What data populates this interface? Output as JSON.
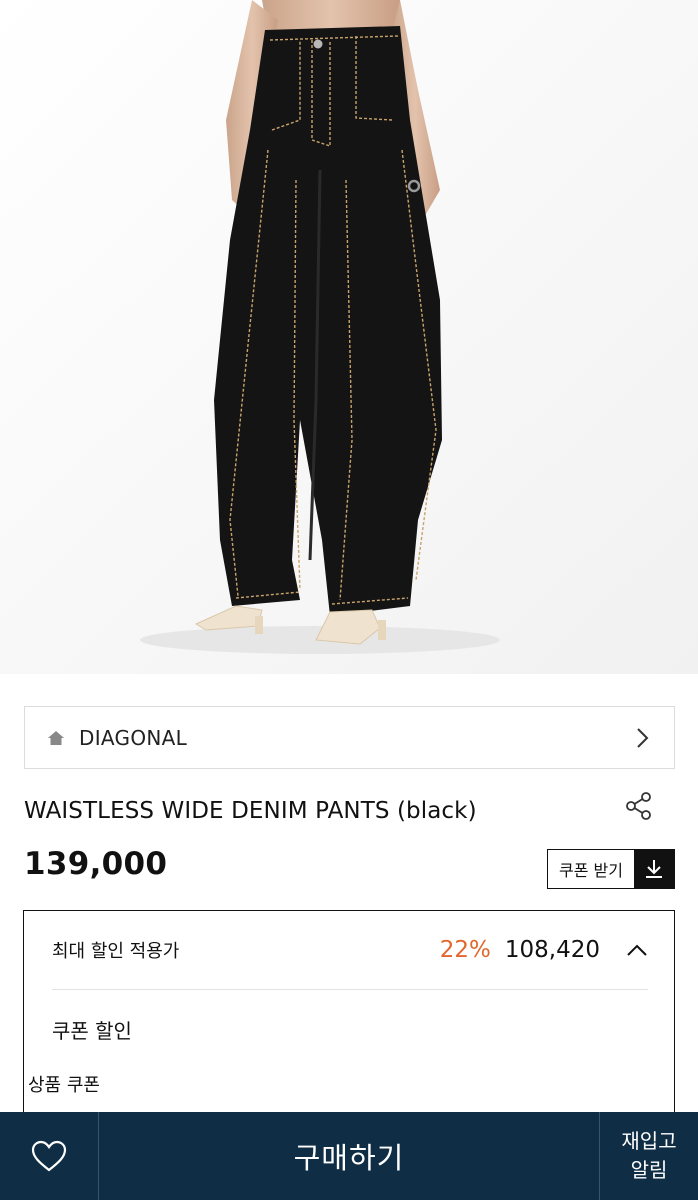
{
  "photo": {
    "alt_icon": "product-photo"
  },
  "brand": {
    "name": "DIAGONAL",
    "icon": "home-icon",
    "nav_icon": "chevron-right-icon"
  },
  "product": {
    "title": "WAISTLESS WIDE DENIM PANTS (black)",
    "price": "139,000",
    "share_icon": "share-icon"
  },
  "coupon_button": {
    "label": "쿠폰 받기",
    "icon": "download-icon"
  },
  "discount": {
    "max_label": "최대 할인 적용가",
    "rate": "22%",
    "sale_price": "108,420",
    "toggle_icon": "chevron-up-icon",
    "coupon_section_title": "쿠폰 할인",
    "product_coupon_label": "상품 쿠폰"
  },
  "bottom_bar": {
    "wish_icon": "heart-icon",
    "buy_label": "구매하기",
    "restock_line1": "재입고",
    "restock_line2": "알림"
  },
  "colors": {
    "accent_rate": "#e2672c",
    "bottom_bar": "#0f2d44"
  }
}
